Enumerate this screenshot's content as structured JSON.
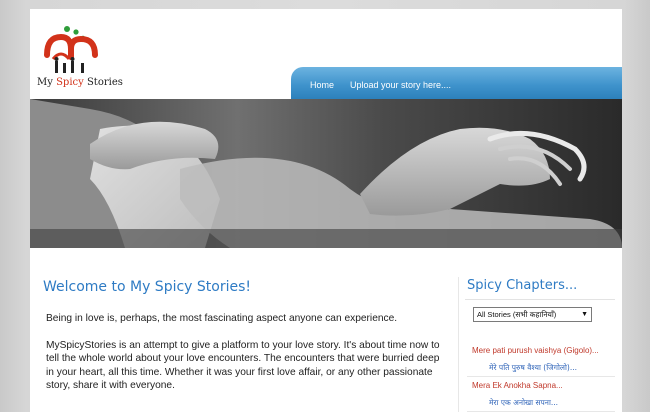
{
  "header": {
    "logo": {
      "prefix": "My ",
      "highlight": "Spicy",
      "suffix": " Stories"
    },
    "nav": [
      {
        "label": "Home"
      },
      {
        "label": "Upload your story here...."
      }
    ]
  },
  "main": {
    "title": "Welcome to My Spicy Stories!",
    "paragraphs": [
      "Being in love is, perhaps, the most fascinating aspect anyone can experience.",
      "MySpicyStories is an attempt to give a platform to your love story. It's about time now to tell the whole world about your love encounters. The encounters that were burried deep in your heart, all this time. Whether it was your first love affair, or any other passionate story, share it with everyone."
    ]
  },
  "sidebar": {
    "title": "Spicy Chapters...",
    "select": {
      "value": "All Stories (सभी कहानियाँ)"
    },
    "stories": [
      {
        "title": "Mere pati purush vaishya (Gigolo)...",
        "subtitle": "मेरे पति पुरुष वैश्या (जिगोलो)..."
      },
      {
        "title": "Mera Ek Anokha Sapna...",
        "subtitle": "मेरा एक अनोखा सपना..."
      }
    ]
  },
  "colors": {
    "accent": "#2e7bc4",
    "nav": "#3f93cc",
    "story_title": "#c0392b",
    "story_sub": "#2e63b8",
    "logo_red": "#d2321a"
  }
}
